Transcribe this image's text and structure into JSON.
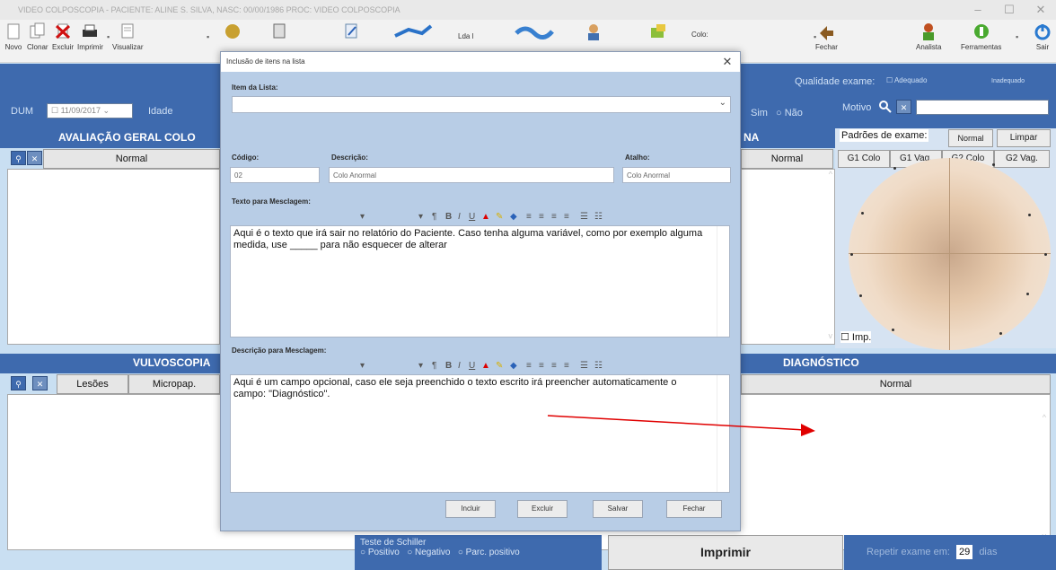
{
  "window": {
    "title": "VIDEO COLPOSCOPIA - PACIENTE: ALINE S. SILVA, NASC: 00/00/1986 PROC: VIDEO COLPOSCOPIA",
    "minimize": "–",
    "maximize": "☐",
    "close": "✕"
  },
  "toolbar": {
    "novo": "Novo",
    "clonar": "Clonar",
    "excluir": "Excluir",
    "imprimir": "Imprimir",
    "visualizar": "Visualizar",
    "colo": "Colo:",
    "lda": "Lda l",
    "fechar": "Fechar",
    "analista": "Analista",
    "ferramentas": "Ferramentas",
    "sair": "Sair"
  },
  "header": {
    "dum_label": "DUM",
    "dum_value": "11/09/2017",
    "idade_label": "Idade",
    "sim_label": "Sim",
    "nao_label": "Não",
    "qualidade_label": "Qualidade exame:",
    "adequado_label": "Adequado",
    "inadequado_label": "Inadequado",
    "motivo_label": "Motivo"
  },
  "avaliacao": {
    "title": "AVALIAÇÃO GERAL COLO",
    "normal_col": "Normal",
    "right_title": "NA",
    "right_normal": "Normal"
  },
  "padroes": {
    "label": "Padrões de exame:",
    "normal_btn": "Normal",
    "limpar_btn": "Limpar",
    "tabs": [
      "G1 Colo",
      "G1 Vag.",
      "G2 Colo",
      "G2 Vag."
    ],
    "imp_label": "Imp."
  },
  "vulvoscopia": {
    "title": "VULVOSCOPIA",
    "cols": [
      "Lesões",
      "Micropap."
    ]
  },
  "diagnostico": {
    "title": "DIAGNÓSTICO",
    "normal_col": "Normal"
  },
  "bottom": {
    "schiller_title": "Teste de Schiller",
    "schiller_options": [
      "Positivo",
      "Negativo",
      "Parc. positivo"
    ],
    "imprimir": "Imprimir",
    "repetir_label": "Repetir exame em:",
    "repetir_value": "29",
    "dias": "dias"
  },
  "modal": {
    "title": "Inclusão de itens na lista",
    "item_label": "Item da Lista:",
    "codigo_label": "Código:",
    "codigo_value": "02",
    "descricao_label": "Descrição:",
    "descricao_value": "Colo Anormal",
    "atalho_label": "Atalho:",
    "atalho_value": "Colo Anormal",
    "texto_label": "Texto para Mesclagem:",
    "texto_value": "Aqui é o texto que irá sair no relatório do Paciente. Caso tenha alguma variável, como por exemplo alguma medida, use _____ para não esquecer de alterar",
    "desc_label": "Descrição para Mesclagem:",
    "desc_value": "Aqui é um campo opcional, caso ele seja preenchido o texto escrito irá preencher automaticamente o campo: \"Diagnóstico\".",
    "buttons": {
      "incluir": "Incluir",
      "excluir": "Excluir",
      "salvar": "Salvar",
      "fechar": "Fechar"
    }
  },
  "colors": {
    "header_blue": "#3e6aae",
    "arrow_red": "#e00000"
  }
}
